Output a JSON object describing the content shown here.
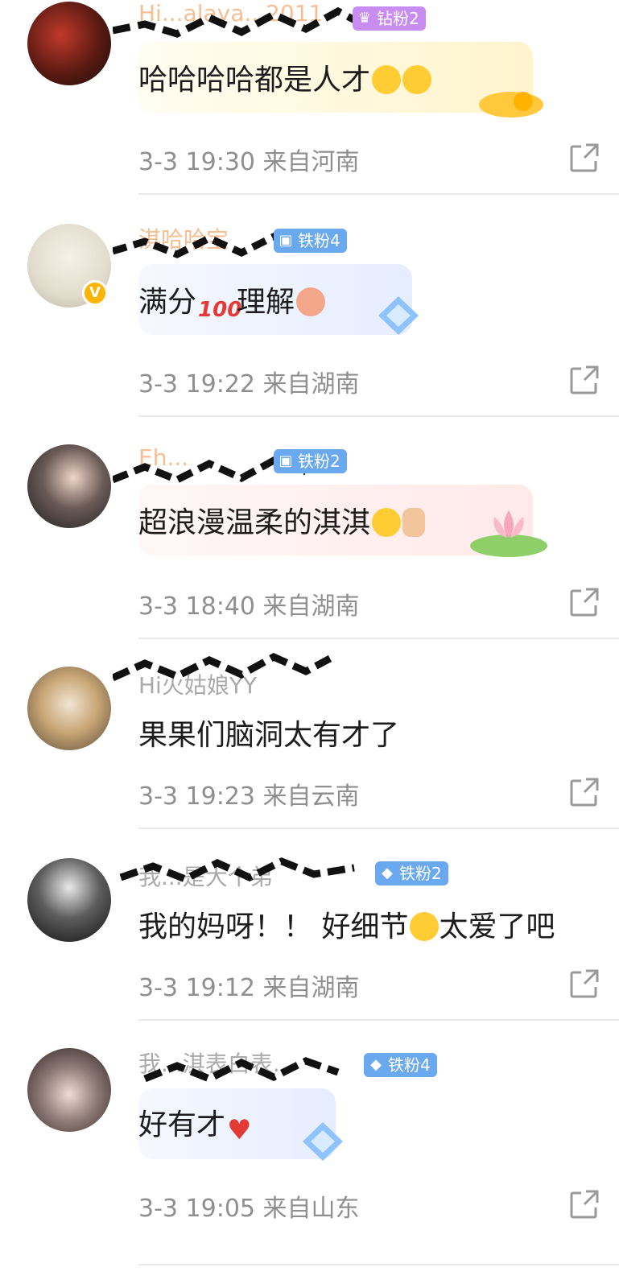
{
  "comments": [
    {
      "name": "Hi...alaya...2011",
      "fan_badge": "钻粉2",
      "text": "哈哈哈哈都是人才",
      "time": "3-3 19:30",
      "location": "来自河南"
    },
    {
      "name": "淇哈哈宝",
      "fan_badge": "铁粉4",
      "text_a": "满分",
      "text_b": "理解",
      "time": "3-3 19:22",
      "location": "来自湖南"
    },
    {
      "name": "Eh...",
      "fan_badge": "铁粉2",
      "text": "超浪漫温柔的淇淇",
      "time": "3-3 18:40",
      "location": "来自湖南"
    },
    {
      "name": "Hi火姑娘YY",
      "text": "果果们脑洞太有才了",
      "time": "3-3 19:23",
      "location": "来自云南"
    },
    {
      "name": "我...是大个弟",
      "fan_badge": "铁粉2",
      "text_a": "我的妈呀！！ 好细节",
      "text_b": "太爱了吧",
      "time": "3-3 19:12",
      "location": "来自湖南"
    },
    {
      "name": "我...淇表白表...",
      "fan_badge": "铁粉4",
      "text": "好有才",
      "time": "3-3 19:05",
      "location": "来自山东"
    }
  ],
  "colors": {
    "diamond_badge": "#c98cf0",
    "iron_badge": "#6aa8f0",
    "meta_text": "#8f8f8f"
  },
  "icons": {
    "share": "share-icon",
    "verified": "verified-badge-icon"
  }
}
